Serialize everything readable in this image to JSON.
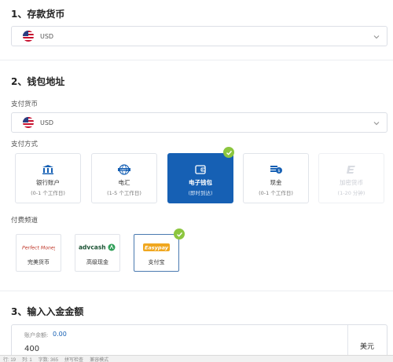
{
  "section1": {
    "title": "1、存款货币",
    "currency": "USD"
  },
  "section2": {
    "title": "2、钱包地址",
    "currency_label": "支付货币",
    "currency": "USD",
    "method_label": "支付方式",
    "methods": [
      {
        "name": "银行账户",
        "sub": "(0-1 个工作日)",
        "icon": "bank-icon"
      },
      {
        "name": "电汇",
        "sub": "(1-5 个工作日)",
        "icon": "swift-globe-icon"
      },
      {
        "name": "电子钱包",
        "sub": "(即时到达)",
        "icon": "wallet-icon"
      },
      {
        "name": "现金",
        "sub": "(0-1 个工作日)",
        "icon": "cash-icon"
      },
      {
        "name": "加密货币",
        "sub": "(1-20 分钟)",
        "icon": "crypto-icon"
      }
    ],
    "channel_label": "付费频道",
    "channels": [
      {
        "name": "完美货币",
        "logo": "Perfect Money"
      },
      {
        "name": "高级现金",
        "logo": "advcash"
      },
      {
        "name": "支付宝",
        "logo": "Easypay"
      }
    ]
  },
  "section3": {
    "title": "3、输入入金金额",
    "balance_label": "账户余额:",
    "balance": "0.00",
    "amount": "400",
    "unit": "美元"
  },
  "statusbar": {
    "row": "行: 19",
    "col": "列: 1",
    "chars": "字数: 365",
    "spellcheck": "拼写检查",
    "mode": "兼容模式"
  },
  "colors": {
    "primary": "#1660b4",
    "check": "#8cc63f",
    "border": "#dcdfe6"
  }
}
